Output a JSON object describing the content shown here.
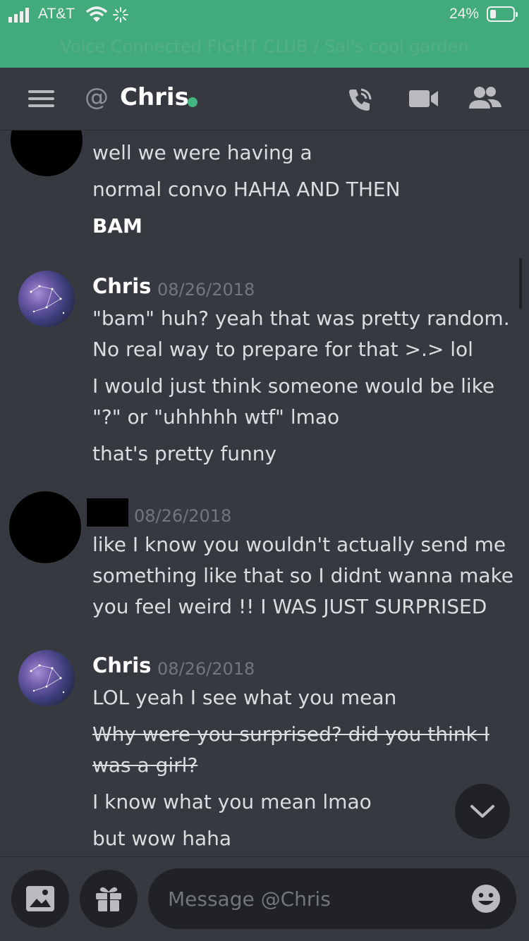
{
  "status_bar": {
    "carrier": "AT&T",
    "battery": "24%",
    "voice_banner": "Voice Connected FIGHT CLUB / Sal's cool garden"
  },
  "header": {
    "at_symbol": "@",
    "title": "Chris",
    "online": true
  },
  "messages": {
    "group1": {
      "lines": [
        "well we were having a",
        "normal convo HAHA AND THEN",
        "BAM"
      ]
    },
    "group2": {
      "author": "Chris",
      "timestamp": "08/26/2018",
      "lines": [
        "\"bam\" huh? yeah that was pretty random.",
        "No real way to prepare for that >.> lol",
        "I would just think someone would be like",
        "\"?\" or \"uhhhhh wtf\" lmao",
        "that's pretty funny"
      ]
    },
    "group3": {
      "timestamp": "08/26/2018",
      "lines": [
        "like I know you wouldn't actually send me",
        "something like that so I didnt wanna make",
        "you feel weird !! I WAS JUST SURPRISED"
      ]
    },
    "group4": {
      "author": "Chris",
      "timestamp": "08/26/2018",
      "lines": [
        "LOL yeah I see what you mean",
        "Why were you surprised? did you think I",
        "was a girl?",
        "I know what you mean lmao",
        "but wow haha"
      ]
    }
  },
  "composer": {
    "placeholder": "Message @Chris"
  },
  "colors": {
    "background": "#36393f",
    "voice_banner": "#43b581",
    "online": "#43b581",
    "timestamp": "#72767d"
  }
}
